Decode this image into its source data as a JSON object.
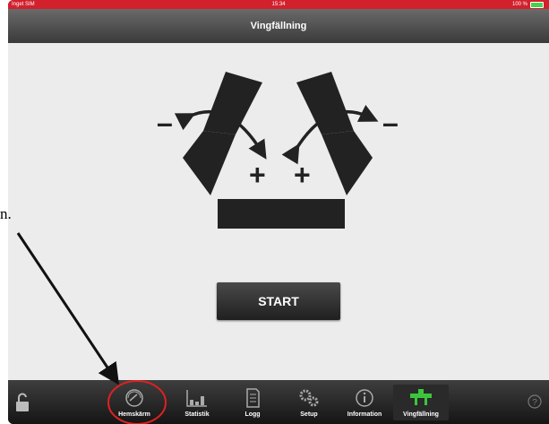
{
  "status_bar": {
    "carrier": "Inget SIM",
    "time": "15:34",
    "battery": "100 %"
  },
  "nav": {
    "title": "Vingfällning"
  },
  "diagram": {
    "minus_symbol": "–",
    "plus_symbol": "+"
  },
  "start_button": {
    "label": "START"
  },
  "tabs": [
    {
      "label": "Hemskärm",
      "icon": "gauge-icon"
    },
    {
      "label": "Statistik",
      "icon": "bar-chart-icon"
    },
    {
      "label": "Logg",
      "icon": "document-icon"
    },
    {
      "label": "Setup",
      "icon": "gears-icon"
    },
    {
      "label": "Information",
      "icon": "info-icon"
    },
    {
      "label": "Vingfällning",
      "icon": "wing-fold-icon"
    }
  ],
  "tab_bar": {
    "help_symbol": "?"
  },
  "annotation": {
    "text": "n."
  },
  "colors": {
    "status_bar": "#d2202c",
    "active_tab_icon": "#3cc53c",
    "annotation_circle": "#e02020"
  }
}
